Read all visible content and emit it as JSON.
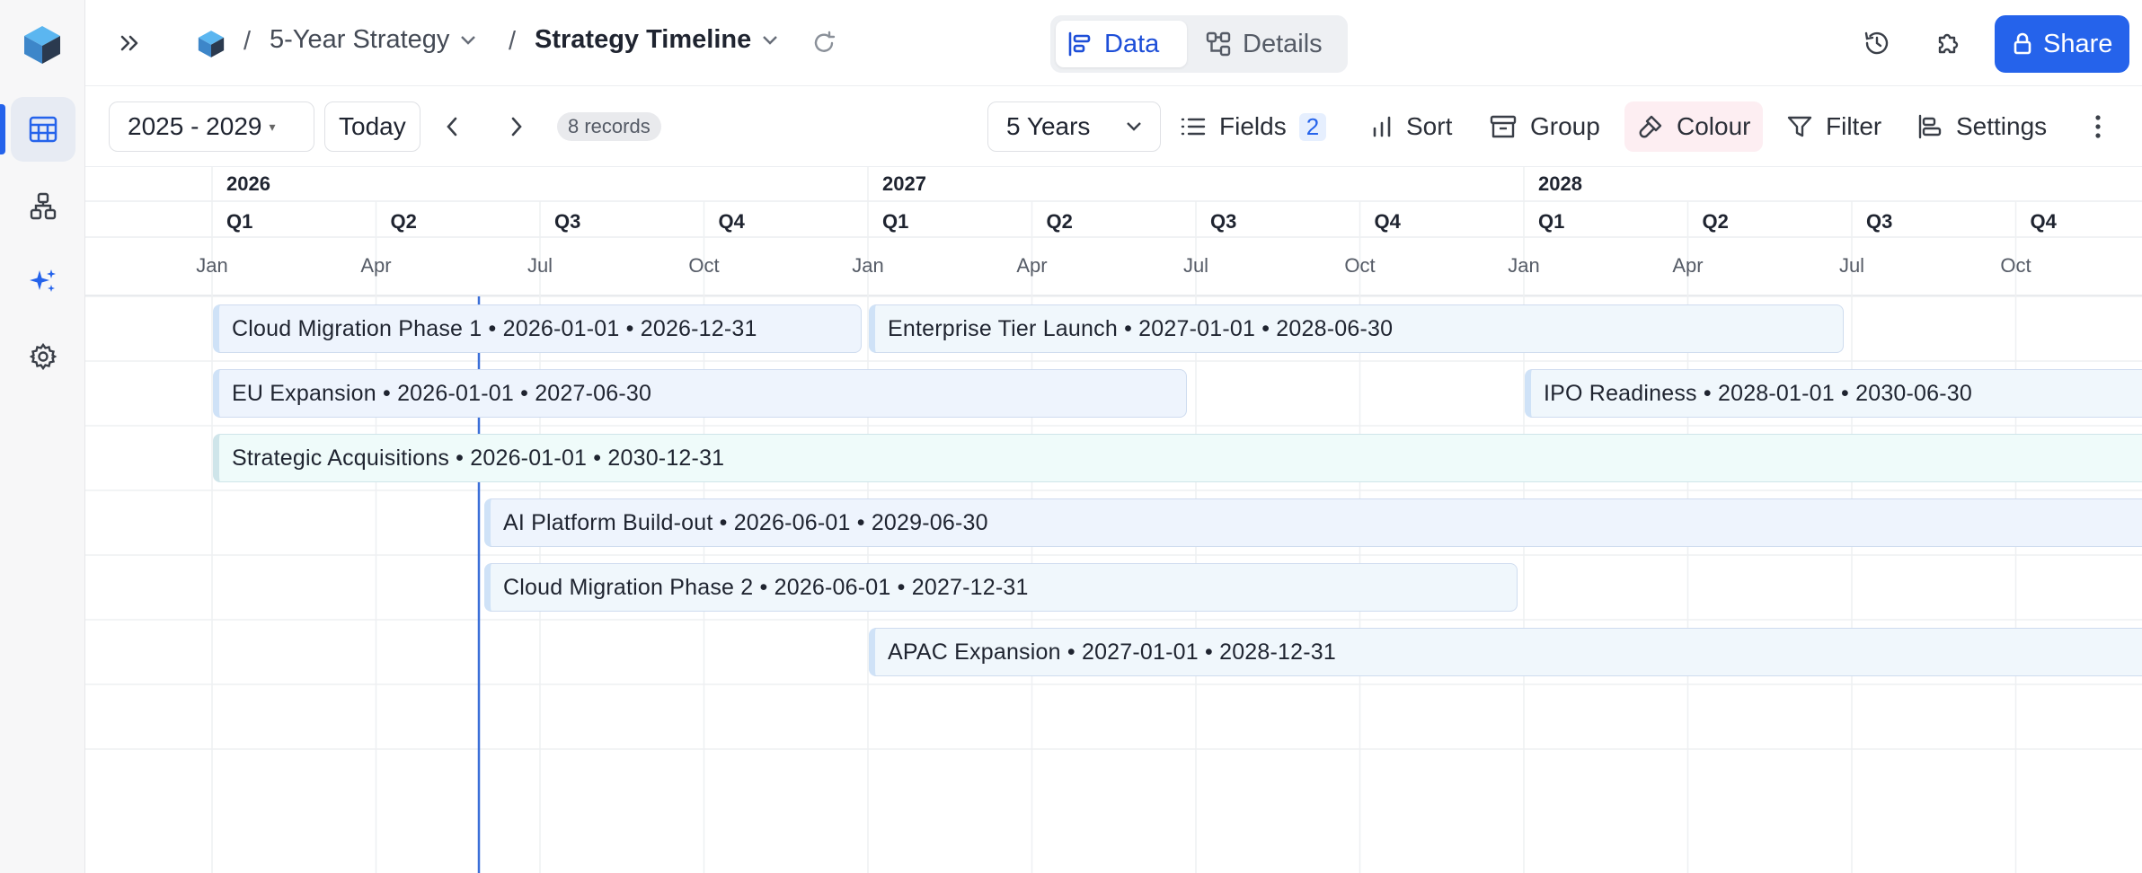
{
  "header": {
    "breadcrumb_base": "5-Year Strategy",
    "breadcrumb_current": "Strategy Timeline",
    "separator": "/",
    "view_toggle": {
      "data_label": "Data",
      "details_label": "Details"
    },
    "share_label": "Share"
  },
  "toolbar": {
    "range_label": "2025 - 2029",
    "today_label": "Today",
    "records_label": "8 records",
    "zoom_label": "5 Years",
    "fields_label": "Fields",
    "fields_count": "2",
    "sort_label": "Sort",
    "group_label": "Group",
    "colour_label": "Colour",
    "filter_label": "Filter",
    "settings_label": "Settings"
  },
  "timeline": {
    "years": [
      "2026",
      "2027",
      "2028"
    ],
    "quarters": [
      "Q1",
      "Q2",
      "Q3",
      "Q4",
      "Q1",
      "Q2",
      "Q3",
      "Q4",
      "Q1",
      "Q2",
      "Q3",
      "Q4"
    ],
    "months": [
      "Jan",
      "Apr",
      "Jul",
      "Oct",
      "Jan",
      "Apr",
      "Jul",
      "Oct",
      "Jan",
      "Apr",
      "Jul",
      "Oct"
    ],
    "today_marker_date": "2026-06-01",
    "records": [
      {
        "label": "Cloud Migration Phase 1 • 2026-01-01 • 2026-12-31",
        "start": "2026-01-01",
        "end": "2026-12-31",
        "row": 0
      },
      {
        "label": "Enterprise Tier Launch • 2027-01-01 • 2028-06-30",
        "start": "2027-01-01",
        "end": "2028-06-30",
        "row": 0
      },
      {
        "label": "EU Expansion • 2026-01-01 • 2027-06-30",
        "start": "2026-01-01",
        "end": "2027-06-30",
        "row": 1
      },
      {
        "label": "IPO Readiness • 2028-01-01 • 2030-06-30",
        "start": "2028-01-01",
        "end": "2030-06-30",
        "row": 1
      },
      {
        "label": "Strategic Acquisitions • 2026-01-01 • 2030-12-31",
        "start": "2026-01-01",
        "end": "2030-12-31",
        "row": 2
      },
      {
        "label": "AI Platform Build-out • 2026-06-01 • 2029-06-30",
        "start": "2026-06-01",
        "end": "2029-06-30",
        "row": 3
      },
      {
        "label": "Cloud Migration Phase 2 • 2026-06-01 • 2027-12-31",
        "start": "2026-06-01",
        "end": "2027-12-31",
        "row": 4
      },
      {
        "label": "APAC Expansion • 2027-01-01 • 2028-12-31",
        "start": "2027-01-01",
        "end": "2028-12-31",
        "row": 5
      }
    ]
  }
}
